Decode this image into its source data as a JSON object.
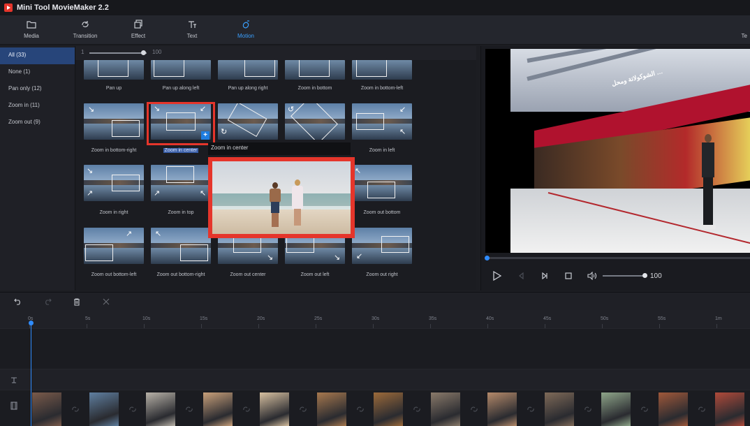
{
  "app": {
    "title": "Mini Tool MovieMaker 2.2"
  },
  "toolbar": {
    "tabs": [
      {
        "label": "Media",
        "icon": "folder-icon"
      },
      {
        "label": "Transition",
        "icon": "transition-icon"
      },
      {
        "label": "Effect",
        "icon": "effect-icon"
      },
      {
        "label": "Text",
        "icon": "text-icon"
      },
      {
        "label": "Motion",
        "icon": "motion-icon"
      }
    ],
    "active_tab": "Motion",
    "edge_label": "Te"
  },
  "categories": [
    {
      "label": "All (33)",
      "active": true
    },
    {
      "label": "None (1)"
    },
    {
      "label": "Pan only (12)"
    },
    {
      "label": "Zoom in (11)"
    },
    {
      "label": "Zoom out (9)"
    }
  ],
  "zoom_slider": {
    "min": "1",
    "max": "100"
  },
  "motions": {
    "row0": [
      "Pan up",
      "Pan up along left",
      "Pan up along right",
      "Zoom in bottom",
      "Zoom in bottom-left"
    ],
    "row1": [
      "Zoom in bottom-right",
      "Zoom in center",
      "",
      "",
      "Zoom in left"
    ],
    "row2": [
      "Zoom in right",
      "Zoom in top",
      "",
      "",
      "Zoom out bottom"
    ],
    "row3": [
      "Zoom out bottom-left",
      "Zoom out bottom-right",
      "Zoom out center",
      "Zoom out left",
      "Zoom out right"
    ],
    "selected": "Zoom in center"
  },
  "tooltip": {
    "text": "Zoom in center"
  },
  "player": {
    "video_sign_text": "الشوكولاتة ومحل …",
    "volume": "100",
    "progress": 0
  },
  "timeline": {
    "ticks": [
      "0s",
      "5s",
      "10s",
      "15s",
      "20s",
      "25s",
      "30s",
      "35s",
      "40s",
      "45s",
      "50s",
      "55s",
      "1m"
    ],
    "clip_count": 13,
    "clip_colors": [
      "#7a5a4a",
      "#5f7fa0",
      "#b8b2a8",
      "#c9a07a",
      "#d7c0a0",
      "#a7784e",
      "#9c6a3a",
      "#8a7a6a",
      "#b58a6a",
      "#7f6a58",
      "#8fa68a",
      "#a0583a",
      "#b04a3a"
    ]
  },
  "colors": {
    "accent": "#2f8cff",
    "highlight": "#e5352b",
    "selection": "#27457a"
  }
}
